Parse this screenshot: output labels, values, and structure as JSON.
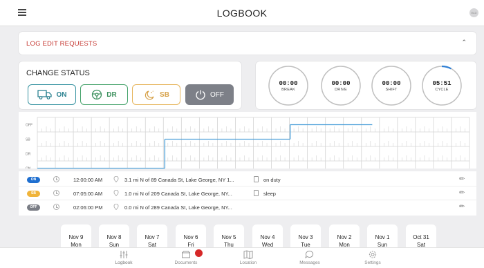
{
  "header": {
    "title": "LOGBOOK",
    "avatar_initials": "ELD"
  },
  "edit_requests": {
    "label": "LOG EDIT REQUESTS"
  },
  "change_status": {
    "title": "CHANGE STATUS",
    "buttons": {
      "on": "ON",
      "dr": "DR",
      "sb": "SB",
      "off": "OFF"
    },
    "active": "OFF"
  },
  "timers": [
    {
      "value": "00:00",
      "label": "BREAK",
      "progress": 0
    },
    {
      "value": "00:00",
      "label": "DRIVE",
      "progress": 0
    },
    {
      "value": "00:00",
      "label": "SHIFT",
      "progress": 0
    },
    {
      "value": "05:51",
      "label": "CYCLE",
      "progress": 0.08
    }
  ],
  "chart_data": {
    "type": "line",
    "rows": [
      "OFF",
      "SB",
      "DR",
      "ON"
    ],
    "x_unit": "hours",
    "xlim": [
      0,
      24
    ],
    "segments": [
      {
        "status": "ON",
        "start": 0,
        "end": 7.08
      },
      {
        "status": "SB",
        "start": 7.08,
        "end": 14.04
      },
      {
        "status": "OFF",
        "start": 14.04,
        "end": 18.6
      }
    ],
    "colors": {
      "line": "#4a9ed8",
      "grid": "#d4d4d4"
    }
  },
  "logs": [
    {
      "badge": "ON",
      "badge_color": "#1f6fd0",
      "time": "12:00:00 AM",
      "location": "3.1 mi N of 89 Canada St, Lake George, NY 1...",
      "note": "on duty"
    },
    {
      "badge": "SB",
      "badge_color": "#f0b43a",
      "time": "07:05:00 AM",
      "location": "1.0 mi N of 209 Canada St, Lake George, NY...",
      "note": "sleep"
    },
    {
      "badge": "OFF",
      "badge_color": "#7a7d85",
      "time": "02:06:00 PM",
      "location": "0.0 mi N of 289 Canada St, Lake George, NY...",
      "note": ""
    }
  ],
  "days": [
    {
      "date": "Nov 9",
      "weekday": "Mon"
    },
    {
      "date": "Nov 8",
      "weekday": "Sun"
    },
    {
      "date": "Nov 7",
      "weekday": "Sat"
    },
    {
      "date": "Nov 6",
      "weekday": "Fri"
    },
    {
      "date": "Nov 5",
      "weekday": "Thu"
    },
    {
      "date": "Nov 4",
      "weekday": "Wed"
    },
    {
      "date": "Nov 3",
      "weekday": "Tue"
    },
    {
      "date": "Nov 2",
      "weekday": "Mon"
    },
    {
      "date": "Nov 1",
      "weekday": "Sun"
    },
    {
      "date": "Oct 31",
      "weekday": "Sat"
    }
  ],
  "nav": [
    {
      "label": "Logbook",
      "icon": "sliders-icon"
    },
    {
      "label": "Documents",
      "icon": "folder-icon",
      "has_badge": true
    },
    {
      "label": "Location",
      "icon": "map-icon"
    },
    {
      "label": "Messages",
      "icon": "chat-icon"
    },
    {
      "label": "Settings",
      "icon": "gear-icon"
    }
  ]
}
